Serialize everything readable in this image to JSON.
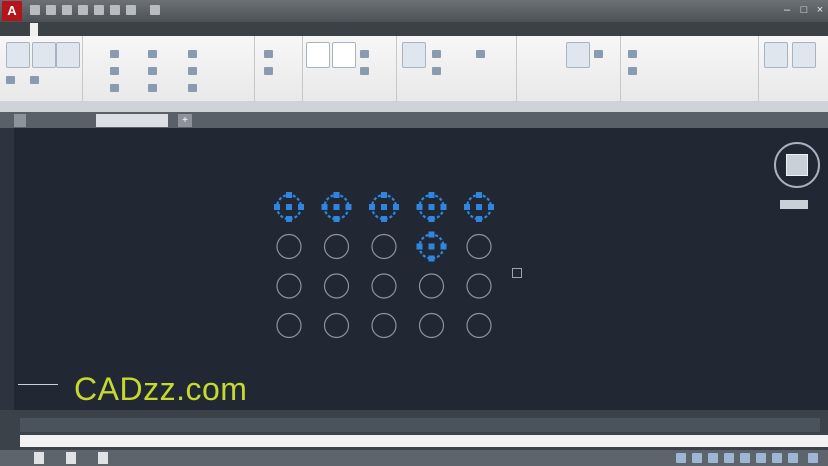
{
  "watermark": "CADzz.com",
  "tabs_count_note": "",
  "ribbon_tabs": [
    "",
    "",
    "",
    "",
    "",
    "",
    "",
    "",
    ""
  ],
  "ribbon_panels": [
    "",
    "",
    "",
    "",
    "",
    "",
    "",
    ""
  ],
  "file_tab": "",
  "command_placeholder": "",
  "circle_grid": {
    "rows": 4,
    "cols": 5,
    "selected": [
      [
        0,
        0
      ],
      [
        0,
        1
      ],
      [
        0,
        2
      ],
      [
        0,
        3
      ],
      [
        0,
        4
      ],
      [
        1,
        3
      ]
    ],
    "colors": {
      "normal": "#8a94a0",
      "selected": "#2f86e0",
      "grip": "#2f86e0"
    }
  },
  "colors": {
    "canvas": "#212833",
    "title_bar": "#5c6166",
    "ribbon": "#ececec",
    "app_logo": "#b4141a",
    "watermark": "#c5d92e"
  }
}
